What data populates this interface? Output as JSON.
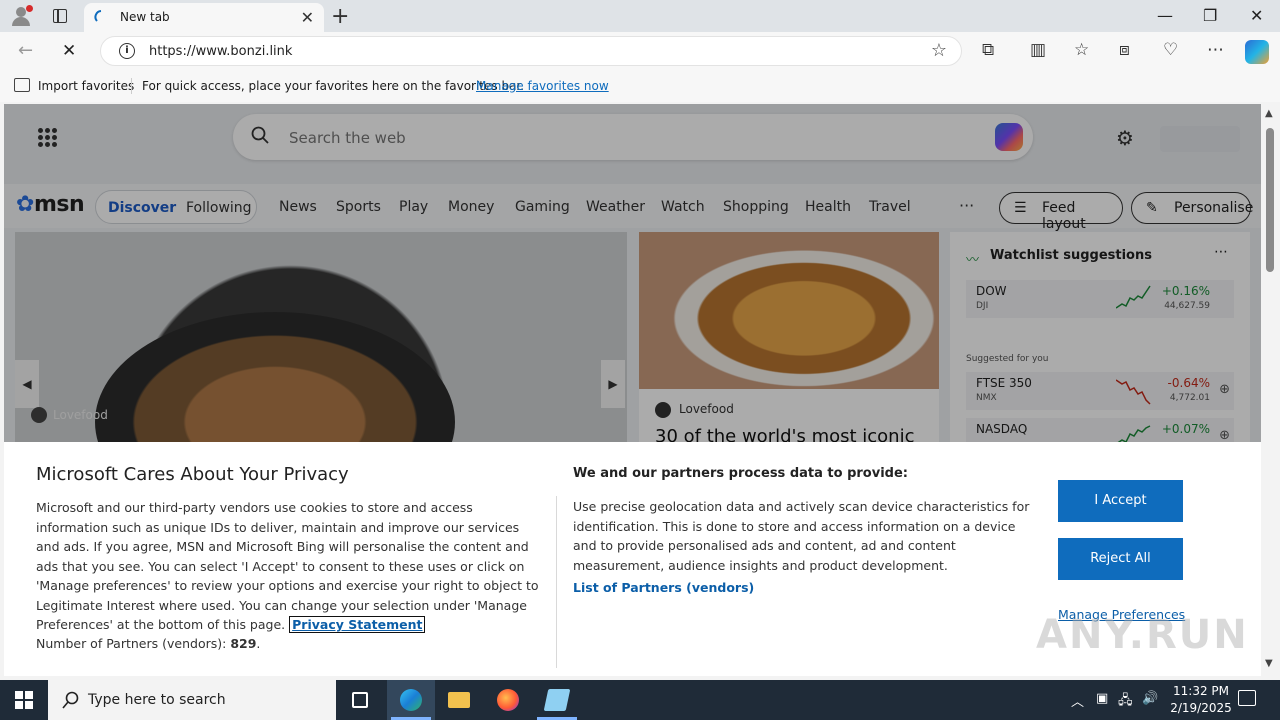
{
  "browser": {
    "tab_title": "New tab",
    "url": "https://www.bonzi.link",
    "favorites_bar": {
      "import_label": "Import favorites",
      "message": "For quick access, place your favorites here on the favorites bar.",
      "manage_link": "Manage favorites now"
    }
  },
  "msn": {
    "search_placeholder": "Search the web",
    "logo": "msn",
    "tabs": {
      "discover": "Discover",
      "following": "Following"
    },
    "nav": [
      "News",
      "Sports",
      "Play",
      "Money",
      "Gaming",
      "Weather",
      "Watch",
      "Shopping",
      "Health",
      "Travel"
    ],
    "more": "···",
    "feed_layout": "Feed layout",
    "personalise": "Personalise",
    "hero_source": "Lovefood",
    "card2": {
      "source": "Lovefood",
      "title": "30 of the world's most iconic"
    },
    "watchlist": {
      "title": "Watchlist suggestions",
      "suggested_label": "Suggested for you",
      "rows": [
        {
          "symbol": "DOW",
          "exchange": "DJI",
          "change": "+0.16%",
          "value": "44,627.59",
          "color": "#1c8a3a"
        },
        {
          "symbol": "FTSE 350",
          "exchange": "NMX",
          "change": "-0.64%",
          "value": "4,772.01",
          "color": "#c42b1c"
        },
        {
          "symbol": "NASDAQ",
          "exchange": "",
          "change": "+0.07%",
          "value": "",
          "color": "#1c8a3a"
        }
      ]
    }
  },
  "privacy": {
    "title": "Microsoft Cares About Your Privacy",
    "body": "Microsoft and our third-party vendors use cookies to store and access information such as unique IDs to deliver, maintain and improve our services and ads. If you agree, MSN and Microsoft Bing will personalise the content and ads that you see. You can select 'I Accept' to consent to these uses or click on 'Manage preferences' to review your options and exercise your right to object to Legitimate Interest where used.  You can change your selection under 'Manage Preferences' at the bottom of this page.",
    "privacy_statement": "Privacy Statement",
    "partners_label": "Number of Partners (vendors):",
    "partners_count": "829",
    "partners_suffix": ".",
    "right_title": "We and our partners process data to provide:",
    "right_body": "Use precise geolocation data and actively scan device characteristics for identification. This is done to store and access information on a device and to provide personalised ads and content, ad and content measurement, audience insights and product development.",
    "list_partners": "List of Partners (vendors)",
    "accept": "I Accept",
    "reject": "Reject All",
    "manage": "Manage Preferences"
  },
  "watermark": "ANY.RUN",
  "taskbar": {
    "search_placeholder": "Type here to search",
    "time": "11:32 PM",
    "date": "2/19/2025"
  },
  "colors": {
    "accent": "#0f6cbd",
    "taskbar": "#1f2b38"
  }
}
